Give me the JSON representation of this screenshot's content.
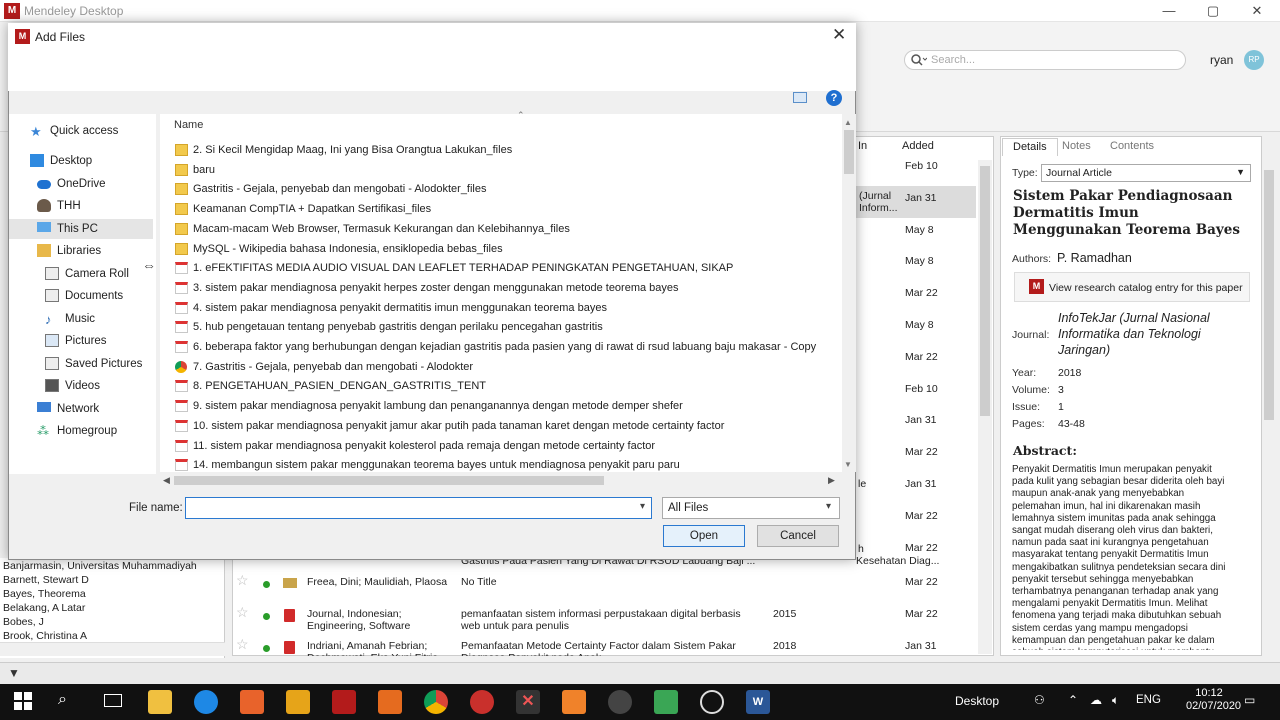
{
  "app": {
    "title": "Mendeley Desktop",
    "minimize": "—",
    "maximize": "▢",
    "close": "✕"
  },
  "toolbar": {
    "search_placeholder": "Search...",
    "user_name": "ryan",
    "user_initials": "RP"
  },
  "side_list": [
    "Banjarmasin, Universitas Muhammadiyah",
    "Barnett, Stewart D",
    "Bayes, Theorema",
    "Belakang, A Latar",
    "Bobes, J",
    "Brook, Christina A"
  ],
  "table": {
    "col_added": "Added",
    "col_in": "In",
    "added_dates": [
      "Feb 10",
      "Jan 31",
      "May 8",
      "May 8",
      "Mar 22",
      "May 8",
      "Mar 22",
      "Feb 10",
      "Jan 31",
      "Mar 22",
      "Jan 31",
      "Mar 22",
      "Mar 22"
    ],
    "partial_in": [
      "(Jurnal",
      "Inform...",
      "le",
      "h",
      "Kesehatan Diag..."
    ],
    "partial_title_row": "Gastritis Pada Pasien Yang Di Rawat Di RSUD Labuang Baji ...",
    "rows": [
      {
        "authors": "Freea, Dini; Maulidiah, Plaosa",
        "title": "No Title",
        "year": "",
        "added": "Mar 22"
      },
      {
        "authors": "Journal, Indonesian; Engineering, Software",
        "title": "pemanfaatan sistem informasi perpustakaan digital berbasis web untuk para penulis",
        "year": "2015",
        "added": "Mar 22"
      },
      {
        "authors": "Indriani, Amanah Febrian; Dachmawati, Eka Yuni Fitria",
        "title": "Pemanfaatan Metode Certainty Factor dalam Sistem Pakar Diagnosa Penyakit pada Anak",
        "year": "2018",
        "added": "Jan 31"
      }
    ]
  },
  "details": {
    "tabs": [
      "Details",
      "Notes",
      "Contents"
    ],
    "type_label": "Type:",
    "type_value": "Journal Article",
    "title": "Sistem Pakar Pendiagnosaan Dermatitis Imun Menggunakan Teorema Bayes",
    "authors_label": "Authors:",
    "authors_value": "P. Ramadhan",
    "catalog_button": "View research catalog entry for this paper",
    "journal_label": "Journal:",
    "journal_value": "InfoTekJar (Jurnal Nasional Informatika dan Teknologi Jaringan)",
    "year_label": "Year:",
    "year_value": "2018",
    "volume_label": "Volume:",
    "volume_value": "3",
    "issue_label": "Issue:",
    "issue_value": "1",
    "pages_label": "Pages:",
    "pages_value": "43-48",
    "abstract_heading": "Abstract:",
    "abstract_text": "Penyakit Dermatitis Imun merupakan penyakit pada kulit yang sebagian besar diderita oleh bayi maupun anak-anak yang menyebabkan pelemahan imun, hal ini dikarenakan masih lemahnya sistem imunitas pada anak sehingga sangat mudah diserang oleh virus dan bakteri, namun pada saat ini kurangnya pengetahuan masyarakat tentang penyakit Dermatitis Imun mengakibatkan sulitnya pendeteksian secara dini penyakit tersebut sehingga menyebabkan terhambatnya penanganan terhadap anak yang mengalami penyakit Dermatitis Imun. Melihat fenomena yang terjadi maka dibutuhkan sebuah sistem cerdas yang mampu mengadopsi kemampuan dan pengetahuan pakar ke dalam sebuah sistem komputerisasi untuk membantu"
  },
  "dialog": {
    "title": "Add Files",
    "close": "✕",
    "help": "?",
    "column_name": "Name",
    "nav": [
      "Quick access",
      "Desktop",
      "OneDrive",
      "THH",
      "This PC",
      "Libraries",
      "Camera Roll",
      "Documents",
      "Music",
      "Pictures",
      "Saved Pictures",
      "Videos",
      "Network",
      "Homegroup"
    ],
    "files": [
      {
        "name": "2. Si Kecil Mengidap Maag, Ini yang Bisa Orangtua Lakukan_files",
        "kind": "folder"
      },
      {
        "name": "baru",
        "kind": "folder"
      },
      {
        "name": "Gastritis - Gejala, penyebab dan mengobati - Alodokter_files",
        "kind": "folder"
      },
      {
        "name": "Keamanan CompTIA + Dapatkan Sertifikasi_files",
        "kind": "folder"
      },
      {
        "name": "Macam-macam Web Browser, Termasuk Kekurangan dan Kelebihannya_files",
        "kind": "folder"
      },
      {
        "name": "MySQL - Wikipedia bahasa Indonesia, ensiklopedia bebas_files",
        "kind": "folder"
      },
      {
        "name": "1. eFEKTIFITAS MEDIA AUDIO VISUAL DAN LEAFLET TERHADAP PENINGKATAN PENGETAHUAN, SIKAP",
        "kind": "doc"
      },
      {
        "name": "3. sistem pakar mendiagnosa penyakit herpes zoster dengan menggunakan metode teorema bayes",
        "kind": "doc"
      },
      {
        "name": "4. sistem pakar mendiagnosa penyakit dermatitis imun menggunakan teorema bayes",
        "kind": "doc"
      },
      {
        "name": "5. hub pengetauan tentang penyebab gastritis dengan perilaku pencegahan gastritis",
        "kind": "doc"
      },
      {
        "name": "6. beberapa faktor yang berhubungan dengan kejadian gastritis pada pasien yang di rawat di rsud labuang baju makasar - Copy",
        "kind": "doc"
      },
      {
        "name": "7. Gastritis - Gejala, penyebab dan mengobati - Alodokter",
        "kind": "chrome"
      },
      {
        "name": "8. PENGETAHUAN_PASIEN_DENGAN_GASTRITIS_TENT",
        "kind": "doc"
      },
      {
        "name": "9. sistem pakar mendiagnosa penyakit lambung dan penanganannya dengan metode demper shefer",
        "kind": "doc"
      },
      {
        "name": "10. sistem pakar mendiagnosa penyakit jamur akar putih pada tanaman karet dengan metode certainty factor",
        "kind": "doc"
      },
      {
        "name": "11. sistem pakar mendiagnosa penyakit kolesterol pada remaja dengan metode certainty factor",
        "kind": "doc"
      },
      {
        "name": "14. membangun sistem pakar menggunakan teorema bayes untuk mendiagnosa penyakit paru paru",
        "kind": "doc"
      }
    ],
    "file_name_label": "File name:",
    "file_name_value": "",
    "file_type": "All Files",
    "open_button": "Open",
    "cancel_button": "Cancel"
  },
  "taskbar": {
    "desktop_label": "Desktop",
    "language": "ENG",
    "time": "10:12",
    "date": "02/07/2020"
  }
}
